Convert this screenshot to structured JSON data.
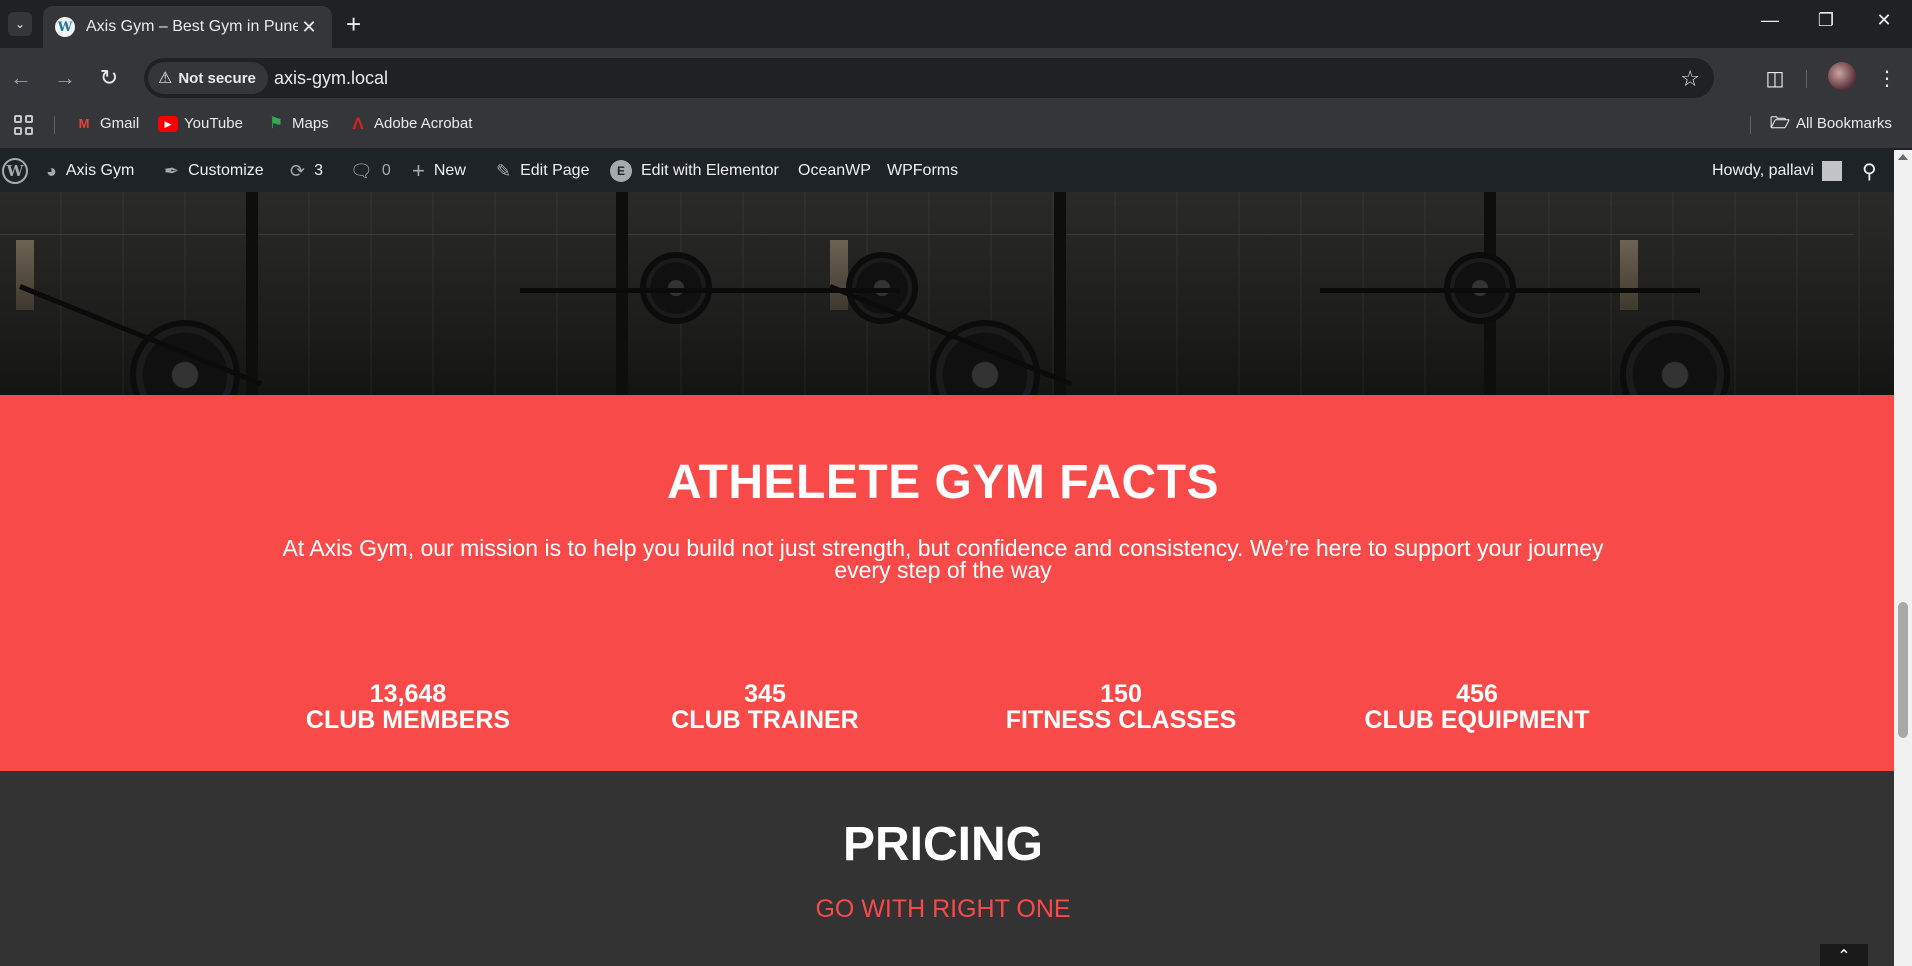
{
  "browser": {
    "tab_title": "Axis Gym – Best Gym in Pune",
    "favicon_letter": "W",
    "security_label": "Not secure",
    "url": "axis-gym.local"
  },
  "bookmarks": {
    "items": [
      {
        "label": "Gmail",
        "icon": "gmail-icon",
        "color": "#ea4335"
      },
      {
        "label": "YouTube",
        "icon": "youtube-icon",
        "color": "#ff0000"
      },
      {
        "label": "Maps",
        "icon": "maps-icon",
        "color": "#34a853"
      },
      {
        "label": "Adobe Acrobat",
        "icon": "acrobat-icon",
        "color": "#d4231e"
      }
    ],
    "all_bookmarks": "All Bookmarks"
  },
  "adminbar": {
    "site_name": "Axis Gym",
    "customize": "Customize",
    "updates_count": "3",
    "comments_count": "0",
    "new": "New",
    "edit_page": "Edit Page",
    "edit_elementor": "Edit with Elementor",
    "oceanwp": "OceanWP",
    "wpforms": "WPForms",
    "howdy": "Howdy, pallavi"
  },
  "facts": {
    "title": "ATHELETE GYM FACTS",
    "description": "At Axis Gym, our mission is to help you build not just strength, but confidence and consistency. We’re here to support your journey every step of the way",
    "stats": [
      {
        "number": "13,648",
        "label": "CLUB MEMBERS"
      },
      {
        "number": "345",
        "label": "CLUB TRAINER"
      },
      {
        "number": "150",
        "label": "FITNESS CLASSES"
      },
      {
        "number": "456",
        "label": "CLUB EQUIPMENT"
      }
    ],
    "background_color": "#f94a4a"
  },
  "pricing": {
    "title": "PRICING",
    "subtitle": "GO WITH RIGHT ONE"
  }
}
